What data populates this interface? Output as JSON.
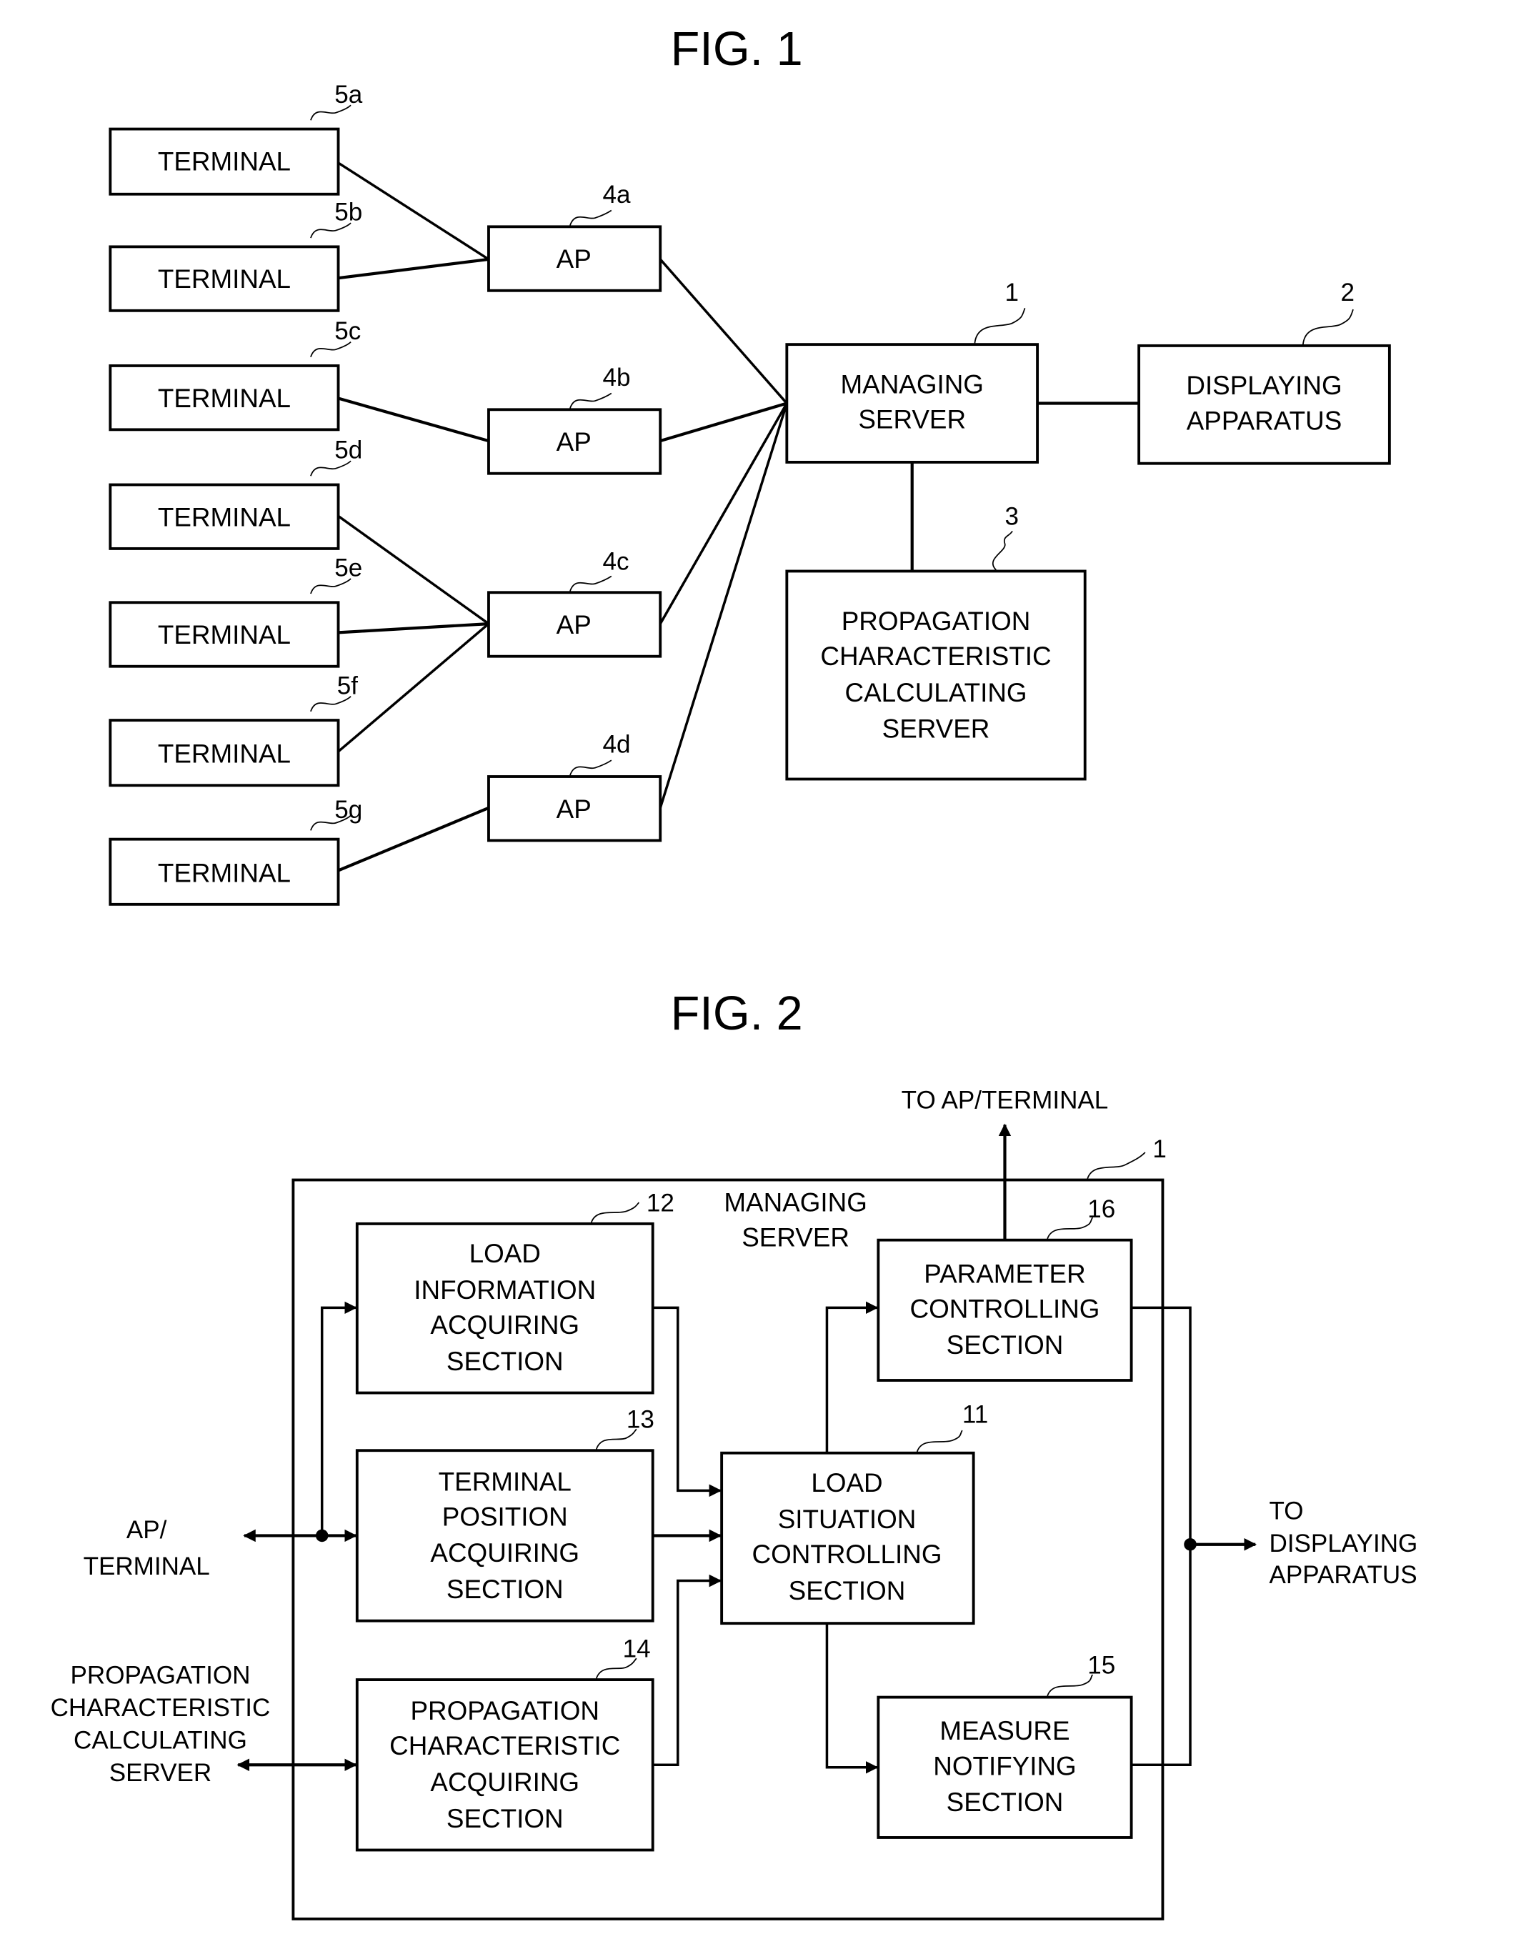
{
  "fig1": {
    "title": "FIG. 1",
    "terminals": [
      {
        "ref": "5a",
        "label": "TERMINAL"
      },
      {
        "ref": "5b",
        "label": "TERMINAL"
      },
      {
        "ref": "5c",
        "label": "TERMINAL"
      },
      {
        "ref": "5d",
        "label": "TERMINAL"
      },
      {
        "ref": "5e",
        "label": "TERMINAL"
      },
      {
        "ref": "5f",
        "label": "TERMINAL"
      },
      {
        "ref": "5g",
        "label": "TERMINAL"
      }
    ],
    "access_points": [
      {
        "ref": "4a",
        "label": "AP"
      },
      {
        "ref": "4b",
        "label": "AP"
      },
      {
        "ref": "4c",
        "label": "AP"
      },
      {
        "ref": "4d",
        "label": "AP"
      }
    ],
    "managing_server": {
      "ref": "1",
      "lines": [
        "MANAGING",
        "SERVER"
      ]
    },
    "displaying_apparatus": {
      "ref": "2",
      "lines": [
        "DISPLAYING",
        "APPARATUS"
      ]
    },
    "propagation_server": {
      "ref": "3",
      "lines": [
        "PROPAGATION",
        "CHARACTERISTIC",
        "CALCULATING",
        "SERVER"
      ]
    },
    "connections": [
      {
        "from": "5a",
        "to": "4a"
      },
      {
        "from": "5b",
        "to": "4a"
      },
      {
        "from": "5c",
        "to": "4b"
      },
      {
        "from": "5d",
        "to": "4c"
      },
      {
        "from": "5e",
        "to": "4c"
      },
      {
        "from": "5f",
        "to": "4c"
      },
      {
        "from": "5g",
        "to": "4d"
      },
      {
        "from": "4a",
        "to": "1"
      },
      {
        "from": "4b",
        "to": "1"
      },
      {
        "from": "4c",
        "to": "1"
      },
      {
        "from": "4d",
        "to": "1"
      },
      {
        "from": "1",
        "to": "2"
      },
      {
        "from": "1",
        "to": "3"
      }
    ]
  },
  "fig2": {
    "title": "FIG. 2",
    "outer": {
      "ref": "1",
      "lines": [
        "MANAGING",
        "SERVER"
      ]
    },
    "to_ap_terminal": "TO AP/TERMINAL",
    "to_displaying": [
      "TO",
      "DISPLAYING",
      "APPARATUS"
    ],
    "ap_terminal": [
      "AP/",
      "TERMINAL"
    ],
    "prop_server_ext": [
      "PROPAGATION",
      "CHARACTERISTIC",
      "CALCULATING",
      "SERVER"
    ],
    "blocks": {
      "b12": {
        "ref": "12",
        "lines": [
          "LOAD",
          "INFORMATION",
          "ACQUIRING",
          "SECTION"
        ]
      },
      "b13": {
        "ref": "13",
        "lines": [
          "TERMINAL",
          "POSITION",
          "ACQUIRING",
          "SECTION"
        ]
      },
      "b14": {
        "ref": "14",
        "lines": [
          "PROPAGATION",
          "CHARACTERISTIC",
          "ACQUIRING",
          "SECTION"
        ]
      },
      "b11": {
        "ref": "11",
        "lines": [
          "LOAD",
          "SITUATION",
          "CONTROLLING",
          "SECTION"
        ]
      },
      "b16": {
        "ref": "16",
        "lines": [
          "PARAMETER",
          "CONTROLLING",
          "SECTION"
        ]
      },
      "b15": {
        "ref": "15",
        "lines": [
          "MEASURE",
          "NOTIFYING",
          "SECTION"
        ]
      }
    }
  }
}
